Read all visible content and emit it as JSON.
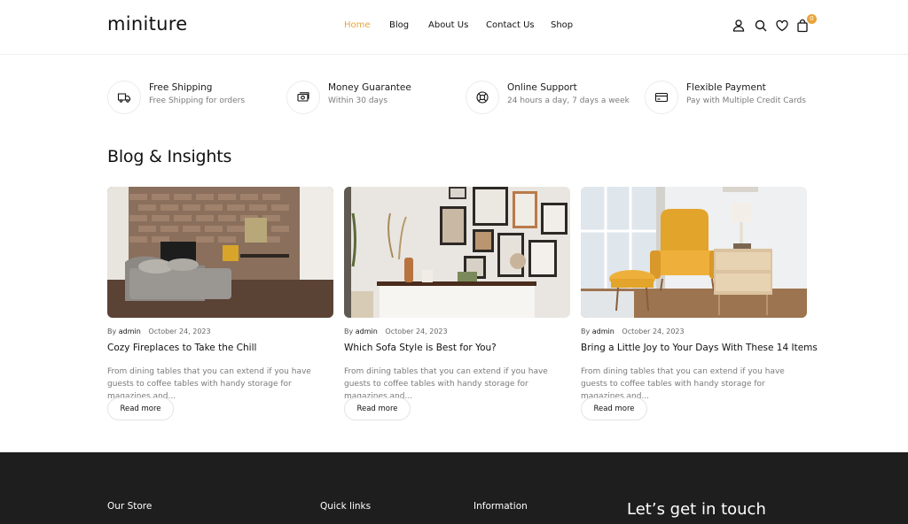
{
  "brand": {
    "logo": "miniture",
    "accent": "#e8a43a"
  },
  "nav": {
    "items": [
      {
        "label": "Home",
        "active": true
      },
      {
        "label": "Blog",
        "active": false
      },
      {
        "label": "About Us",
        "active": false
      },
      {
        "label": "Contact Us",
        "active": false
      },
      {
        "label": "Shop",
        "active": false
      }
    ]
  },
  "header_icons": {
    "account": "user-icon",
    "search": "search-icon",
    "wishlist": "heart-icon",
    "cart": "bag-icon",
    "cart_count": "0"
  },
  "features": [
    {
      "icon": "truck-icon",
      "title": "Free Shipping",
      "subtitle": "Free Shipping for orders"
    },
    {
      "icon": "money-icon",
      "title": "Money Guarantee",
      "subtitle": "Within 30 days"
    },
    {
      "icon": "lifebuoy-icon",
      "title": "Online Support",
      "subtitle": "24 hours a day, 7 days a week"
    },
    {
      "icon": "card-icon",
      "title": "Flexible Payment",
      "subtitle": "Pay with Multiple Credit Cards"
    }
  ],
  "blog": {
    "title": "Blog & Insights",
    "posts": [
      {
        "by": "By",
        "author": "admin",
        "date": "October 24, 2023",
        "title": "Cozy Fireplaces to Take the Chill",
        "excerpt": "From dining tables that you can extend if you have guests to coffee tables with handy storage for magazines and...",
        "cta": "Read more"
      },
      {
        "by": "By",
        "author": "admin",
        "date": "October 24, 2023",
        "title": "Which Sofa Style is Best for You?",
        "excerpt": "From dining tables that you can extend if you have guests to coffee tables with handy storage for magazines and...",
        "cta": "Read more"
      },
      {
        "by": "By",
        "author": "admin",
        "date": "October 24, 2023",
        "title": "Bring a Little Joy to Your Days With These 14 Items",
        "excerpt": "From dining tables that you can extend if you have guests to coffee tables with handy storage for magazines and...",
        "cta": "Read more"
      }
    ]
  },
  "footer": {
    "our_store": "Our Store",
    "quick_links": "Quick links",
    "information": "Information",
    "get_in_touch": "Let’s get in touch"
  }
}
